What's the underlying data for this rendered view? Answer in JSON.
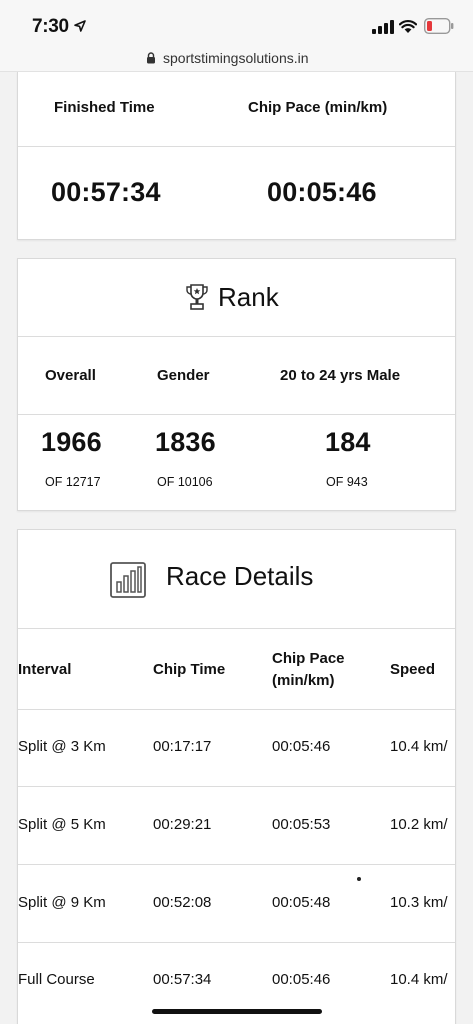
{
  "status_bar": {
    "time": "7:30"
  },
  "browser": {
    "url": "sportstimingsolutions.in"
  },
  "finish": {
    "finished_time_label": "Finished Time",
    "chip_pace_label": "Chip Pace (min/km)",
    "finished_time_value": "00:57:34",
    "chip_pace_value": "00:05:46"
  },
  "rank": {
    "title": "Rank",
    "columns": [
      {
        "label": "Overall",
        "value": "1966",
        "of": "OF 12717"
      },
      {
        "label": "Gender",
        "value": "1836",
        "of": "OF 10106"
      },
      {
        "label": "20 to 24 yrs Male",
        "value": "184",
        "of": "OF 943"
      }
    ]
  },
  "race_details": {
    "title": "Race Details",
    "headers": [
      "Interval",
      "Chip Time",
      "Chip Pace",
      "(min/km)",
      "Speed"
    ],
    "rows": [
      {
        "interval": "Split @ 3 Km",
        "chip_time": "00:17:17",
        "chip_pace": "00:05:46",
        "speed": "10.4 km/"
      },
      {
        "interval": "Split @ 5 Km",
        "chip_time": "00:29:21",
        "chip_pace": "00:05:53",
        "speed": "10.2 km/"
      },
      {
        "interval": "Split @ 9 Km",
        "chip_time": "00:52:08",
        "chip_pace": "00:05:48",
        "speed": "10.3 km/"
      },
      {
        "interval": "Full Course",
        "chip_time": "00:57:34",
        "chip_pace": "00:05:46",
        "speed": "10.4 km/"
      }
    ]
  }
}
